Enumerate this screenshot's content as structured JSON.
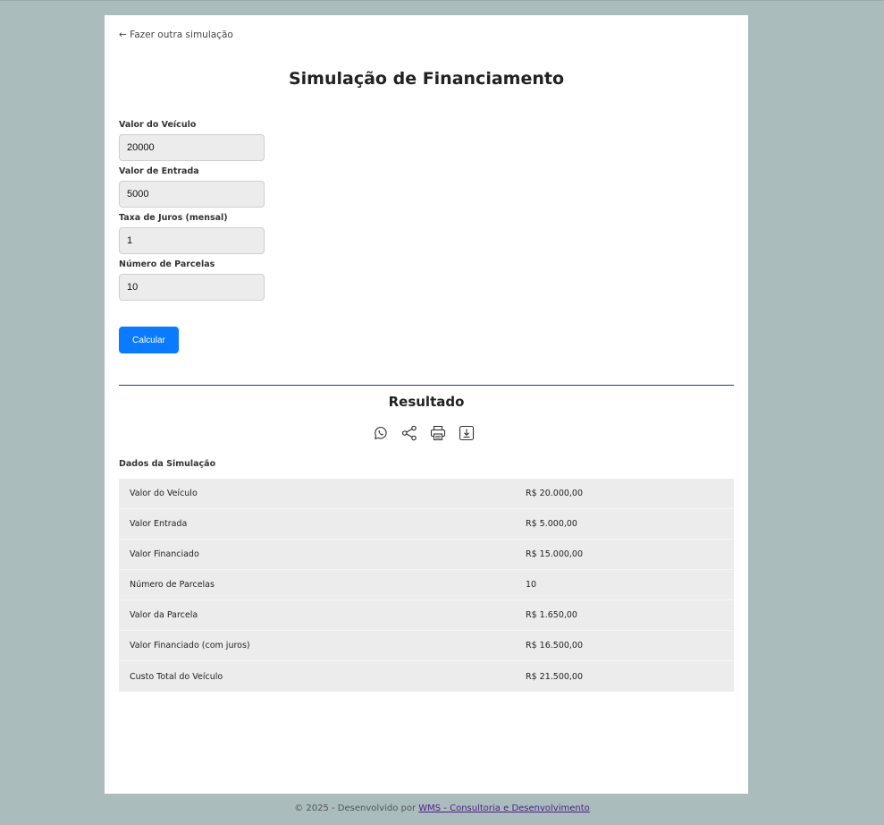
{
  "nav": {
    "back_label": "← Fazer outra simulação"
  },
  "page": {
    "title": "Simulação de Financiamento"
  },
  "form": {
    "fields": [
      {
        "label": "Valor do Veículo",
        "value": "20000"
      },
      {
        "label": "Valor de Entrada",
        "value": "5000"
      },
      {
        "label": "Taxa de Juros (mensal)",
        "value": "1"
      },
      {
        "label": "Número de Parcelas",
        "value": "10"
      }
    ],
    "submit_label": "Calcular"
  },
  "result": {
    "title": "Resultado",
    "actions": [
      "whatsapp-icon",
      "share-icon",
      "print-icon",
      "download-icon"
    ],
    "section_label": "Dados da Simulação",
    "rows": [
      {
        "label": "Valor do Veículo",
        "value": "R$ 20.000,00"
      },
      {
        "label": "Valor Entrada",
        "value": "R$ 5.000,00"
      },
      {
        "label": "Valor Financiado",
        "value": "R$ 15.000,00"
      },
      {
        "label": "Número de Parcelas",
        "value": "10"
      },
      {
        "label": "Valor da Parcela",
        "value": "R$ 1.650,00"
      },
      {
        "label": "Valor Financiado (com juros)",
        "value": "R$ 16.500,00"
      },
      {
        "label": "Custo Total do Veículo",
        "value": "R$ 21.500,00"
      }
    ]
  },
  "footer": {
    "text": "© 2025 - Desenvolvido por",
    "link_label": "WMS - Consultoria e Desenvolvimento"
  },
  "colors": {
    "background": "#abbcbc",
    "primary_button": "#0a7bff",
    "divider": "#1f3f7a",
    "table_background": "#ececec"
  }
}
